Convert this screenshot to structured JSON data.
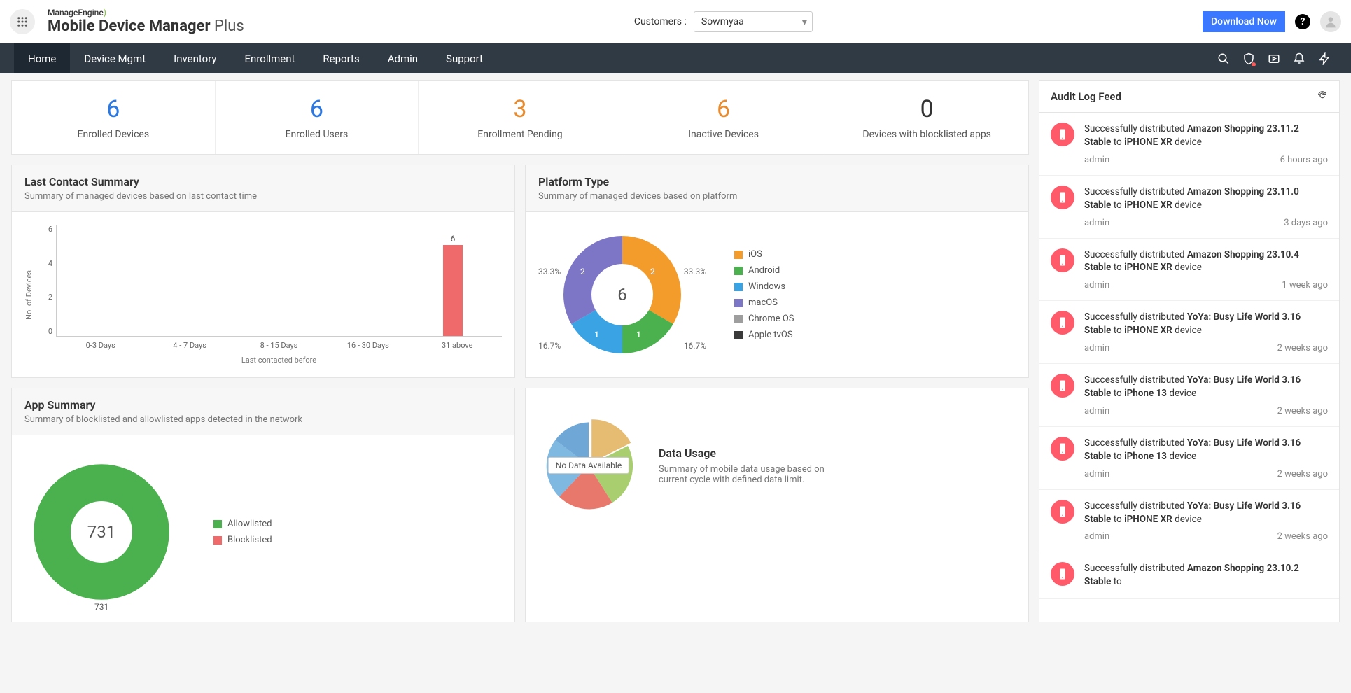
{
  "brand": {
    "top": "ManageEngine",
    "main": "Mobile Device Manager ",
    "suffix": "Plus"
  },
  "customers": {
    "label": "Customers :",
    "value": "Sowmyaa"
  },
  "download_btn": "Download Now",
  "nav": {
    "items": [
      "Home",
      "Device Mgmt",
      "Inventory",
      "Enrollment",
      "Reports",
      "Admin",
      "Support"
    ],
    "active": 0
  },
  "stats": [
    {
      "value": "6",
      "label": "Enrolled Devices",
      "cls": "blue"
    },
    {
      "value": "6",
      "label": "Enrolled Users",
      "cls": "blue"
    },
    {
      "value": "3",
      "label": "Enrollment Pending",
      "cls": "orange"
    },
    {
      "value": "6",
      "label": "Inactive Devices",
      "cls": "orange"
    },
    {
      "value": "0",
      "label": "Devices with blocklisted apps",
      "cls": ""
    }
  ],
  "last_contact": {
    "title": "Last Contact Summary",
    "sub": "Summary of managed devices based on last contact time",
    "y_label": "No. of Devices",
    "x_label": "Last contacted before"
  },
  "platform": {
    "title": "Platform Type",
    "sub": "Summary of managed devices based on platform",
    "center": "6",
    "legend": [
      "iOS",
      "Android",
      "Windows",
      "macOS",
      "Chrome OS",
      "Apple tvOS"
    ],
    "legend_colors": [
      "#f39c2b",
      "#4bb04e",
      "#3aa3e3",
      "#7d76c7",
      "#9e9e9e",
      "#3a3a3a"
    ]
  },
  "platform_pct": {
    "p1": "33.3%",
    "p2": "33.3%",
    "p3": "16.7%",
    "p4": "16.7%"
  },
  "platform_slice": {
    "s1": "2",
    "s2": "2",
    "s3": "1",
    "s4": "1"
  },
  "app_summary": {
    "title": "App Summary",
    "sub": "Summary of blocklisted and allowlisted apps detected in the network",
    "center": "731",
    "legend": [
      "Allowlisted",
      "Blocklisted"
    ],
    "legend_colors": [
      "#4bb04e",
      "#ef6a6a"
    ],
    "bottom_label": "731"
  },
  "data_usage": {
    "title": "Data Usage",
    "sub": "Summary of mobile data usage based on current cycle with defined data limit.",
    "no_data": "No Data Available"
  },
  "audit": {
    "title": "Audit Log Feed"
  },
  "feed": [
    {
      "prefix": "Successfully distributed ",
      "bold1": "Amazon Shopping 23.11.2 Stable",
      "mid": " to ",
      "bold2": "iPHONE XR",
      "suffix": " device",
      "user": "admin",
      "time": "6 hours ago"
    },
    {
      "prefix": "Successfully distributed ",
      "bold1": "Amazon Shopping 23.11.0 Stable",
      "mid": " to ",
      "bold2": "iPHONE XR",
      "suffix": " device",
      "user": "admin",
      "time": "3 days ago"
    },
    {
      "prefix": "Successfully distributed ",
      "bold1": "Amazon Shopping 23.10.4 Stable",
      "mid": " to ",
      "bold2": "iPHONE XR",
      "suffix": " device",
      "user": "admin",
      "time": "1 week ago"
    },
    {
      "prefix": "Successfully distributed ",
      "bold1": "YoYa: Busy Life World 3.16 Stable",
      "mid": " to ",
      "bold2": "iPHONE XR",
      "suffix": " device",
      "user": "admin",
      "time": "2 weeks ago"
    },
    {
      "prefix": "Successfully distributed ",
      "bold1": "YoYa: Busy Life World 3.16 Stable",
      "mid": " to ",
      "bold2": "iPhone 13",
      "suffix": " device",
      "user": "admin",
      "time": "2 weeks ago"
    },
    {
      "prefix": "Successfully distributed ",
      "bold1": "YoYa: Busy Life World 3.16 Stable",
      "mid": " to ",
      "bold2": "iPhone 13",
      "suffix": " device",
      "user": "admin",
      "time": "2 weeks ago"
    },
    {
      "prefix": "Successfully distributed ",
      "bold1": "YoYa: Busy Life World 3.16 Stable",
      "mid": " to ",
      "bold2": "iPHONE XR",
      "suffix": " device",
      "user": "admin",
      "time": "2 weeks ago"
    },
    {
      "prefix": "Successfully distributed ",
      "bold1": "Amazon Shopping 23.10.2 Stable",
      "mid": " to ",
      "bold2": "",
      "suffix": "",
      "user": "",
      "time": ""
    }
  ],
  "chart_data": [
    {
      "id": "last_contact_bar",
      "type": "bar",
      "categories": [
        "0-3 Days",
        "4 - 7 Days",
        "8 - 15 Days",
        "16 - 30 Days",
        "31 above"
      ],
      "values": [
        0,
        0,
        0,
        0,
        6
      ],
      "ylim": [
        0,
        6
      ],
      "y_ticks": [
        0,
        2,
        4,
        6
      ],
      "xlabel": "Last contacted before",
      "ylabel": "No. of Devices",
      "colors": [
        "#ef6a6a"
      ]
    },
    {
      "id": "platform_donut",
      "type": "pie",
      "categories": [
        "iOS",
        "Android",
        "Windows",
        "macOS",
        "Chrome OS",
        "Apple tvOS"
      ],
      "values": [
        2,
        1,
        1,
        2,
        0,
        0
      ],
      "percents": [
        33.3,
        16.7,
        16.7,
        33.3,
        0,
        0
      ],
      "total": 6,
      "colors": [
        "#f39c2b",
        "#4bb04e",
        "#3aa3e3",
        "#7d76c7",
        "#9e9e9e",
        "#3a3a3a"
      ]
    },
    {
      "id": "app_summary_donut",
      "type": "pie",
      "categories": [
        "Allowlisted",
        "Blocklisted"
      ],
      "values": [
        731,
        0
      ],
      "total": 731,
      "colors": [
        "#4bb04e",
        "#ef6a6a"
      ]
    }
  ]
}
